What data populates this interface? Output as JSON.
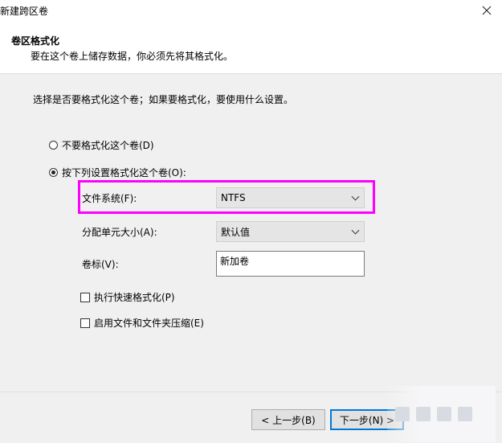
{
  "window": {
    "title": "新建跨区卷"
  },
  "header": {
    "title": "卷区格式化",
    "subtitle": "要在这个卷上储存数据，你必须先将其格式化。"
  },
  "content": {
    "instruction": "选择是否要格式化这个卷；如果要格式化，要使用什么设置。",
    "radio_no_format": {
      "label": "不要格式化这个卷(D)",
      "selected": false
    },
    "radio_format": {
      "label": "按下列设置格式化这个卷(O):",
      "selected": true
    },
    "file_system": {
      "label": "文件系统(F):",
      "value": "NTFS"
    },
    "allocation_unit": {
      "label": "分配单元大小(A):",
      "value": "默认值"
    },
    "volume_label": {
      "label": "卷标(V):",
      "value": "新加卷"
    },
    "quick_format": {
      "label": "执行快速格式化(P)",
      "checked": false
    },
    "compression": {
      "label": "启用文件和文件夹压缩(E)",
      "checked": false
    }
  },
  "footer": {
    "back_label": "< 上一步(B)",
    "next_label": "下一步(N) >"
  },
  "colors": {
    "highlight": "#ff00ff",
    "content_bg": "#f0f0f0",
    "primary_border": "#0078d7"
  }
}
